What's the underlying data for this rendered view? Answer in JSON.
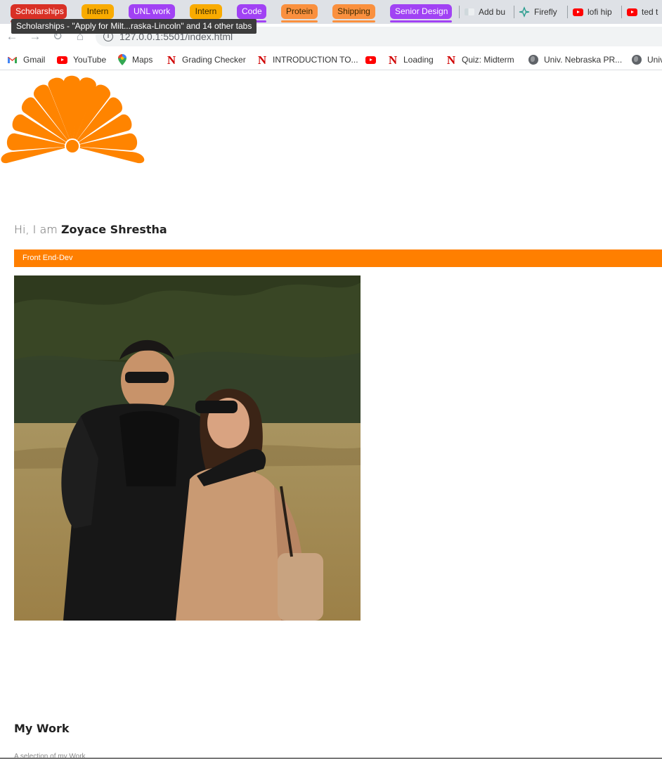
{
  "browser": {
    "tab_groups": [
      {
        "label": "Scholarships",
        "color": "#d93025"
      },
      {
        "label": "Intern",
        "color": "#f9ab00"
      },
      {
        "label": "UNL work",
        "color": "#a142f4"
      },
      {
        "label": "Intern",
        "color": "#f9ab00"
      },
      {
        "label": "Code",
        "color": "#a142f4"
      },
      {
        "label": "Protein",
        "color": "#fa903e"
      },
      {
        "label": "Shipping",
        "color": "#fa903e"
      },
      {
        "label": "Senior Design",
        "color": "#a142f4"
      }
    ],
    "tabs": [
      {
        "label": "Add bu",
        "icon": "doc-icon"
      },
      {
        "label": "Firefly",
        "icon": "firefly-icon"
      },
      {
        "label": "lofi hip",
        "icon": "youtube-icon"
      },
      {
        "label": "ted t",
        "icon": "youtube-icon"
      }
    ],
    "tooltip": "Scholarships - \"Apply for Milt...raska-Lincoln\" and 14 other tabs",
    "url": "127.0.0.1:5501/index.html",
    "bookmarks": [
      {
        "label": "Gmail",
        "icon": "gmail-icon"
      },
      {
        "label": "YouTube",
        "icon": "youtube-icon"
      },
      {
        "label": "Maps",
        "icon": "maps-icon"
      },
      {
        "label": "Grading Checker",
        "icon": "nebraska-n-icon"
      },
      {
        "label": "INTRODUCTION TO...",
        "icon": "nebraska-n-icon"
      },
      {
        "label": "",
        "icon": "youtube-icon"
      },
      {
        "label": "Loading",
        "icon": "nebraska-n-icon"
      },
      {
        "label": "Quiz: Midterm",
        "icon": "nebraska-n-icon"
      },
      {
        "label": "Univ. Nebraska PR...",
        "icon": "globe-icon"
      },
      {
        "label": "Univ",
        "icon": "globe-icon"
      }
    ]
  },
  "page": {
    "greeting_prefix": "Hi, I am ",
    "name": "Zoyace Shrestha",
    "role": "Front End-Dev",
    "accent_color": "#ff7f00",
    "work_title": "My Work",
    "work_subtitle": "A selection of my Work"
  }
}
